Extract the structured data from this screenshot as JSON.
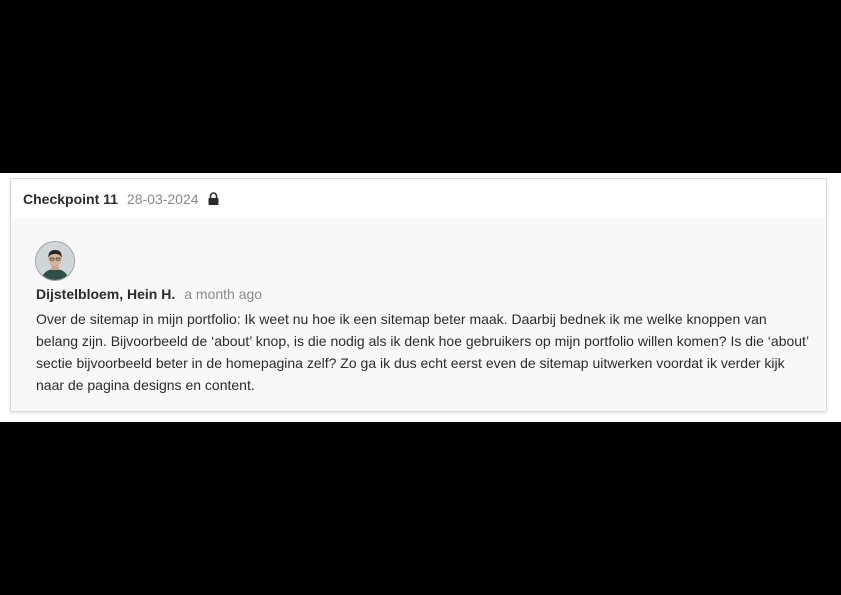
{
  "checkpoint": {
    "title": "Checkpoint 11",
    "date": "28-03-2024",
    "lock_icon": "lock-icon"
  },
  "comment": {
    "author": "Dijstelbloem, Hein H.",
    "time": "a month ago",
    "avatar_icon": "user-avatar",
    "text": "Over de sitemap in mijn portfolio: Ik weet nu hoe ik een sitemap beter maak. Daarbij bednek ik me welke knoppen van belang zijn. Bijvoorbeeld de ‘about’ knop, is die nodig als ik denk hoe gebruikers op mijn portfolio willen komen? Is die ‘about’ sectie bijvoorbeeld beter in de homepagina zelf? Zo ga ik dus echt eerst even de sitemap uitwerken voordat ik verder kijk naar de pagina designs en content."
  },
  "colors": {
    "background": "#000000",
    "card": "#ffffff",
    "card_body": "#f8f8f8",
    "text": "#2b2b2b",
    "muted": "#8a8a8a"
  }
}
